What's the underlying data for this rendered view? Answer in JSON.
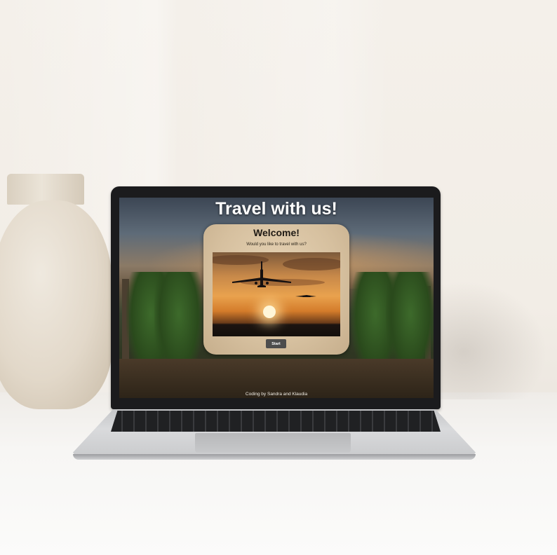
{
  "site": {
    "title": "Travel with us!",
    "footer": "Coding by Sandra and Klaudia"
  },
  "card": {
    "heading": "Welcome!",
    "subtext": "Would you like to travel with us?",
    "start_label": "Start",
    "image_icon": "airplane-sunset-photo"
  },
  "colors": {
    "button": "#4d4d4d",
    "card_bg": "#d6c09f",
    "title_text": "#ffffff"
  }
}
